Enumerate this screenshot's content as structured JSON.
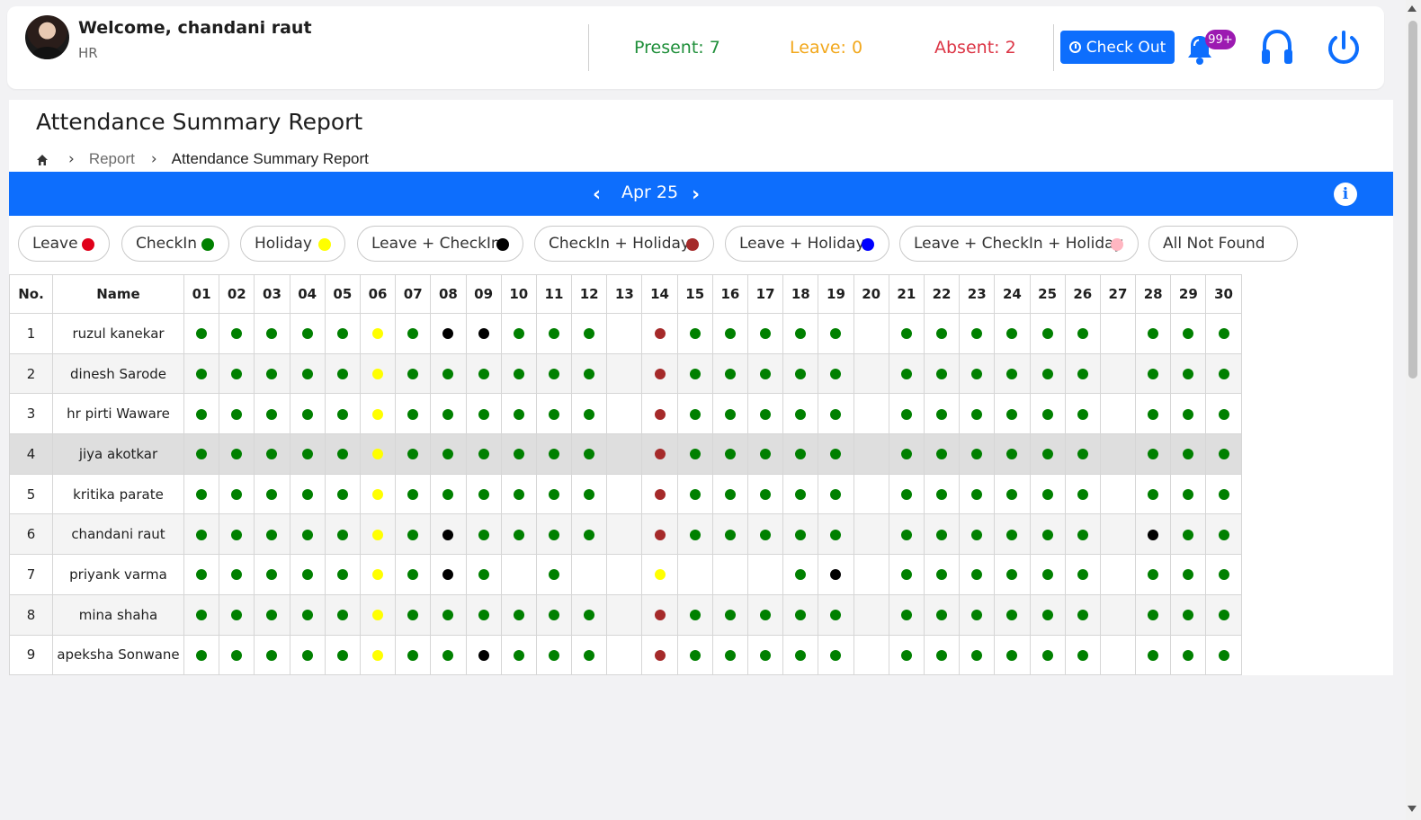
{
  "header": {
    "welcome": "Welcome, chandani raut",
    "role": "HR",
    "present": "Present: 7",
    "leave": "Leave: 0",
    "absent": "Absent: 2",
    "checkout_label": "Check Out",
    "notification_badge": "99+",
    "icons": [
      "clock-icon",
      "bell-icon",
      "headset-icon",
      "power-icon"
    ]
  },
  "page": {
    "title": "Attendance Summary Report",
    "breadcrumb": [
      "Report",
      "Attendance Summary Report"
    ]
  },
  "month": {
    "label": "Apr 25",
    "prev": "‹",
    "next": "›",
    "info": "i"
  },
  "legend": [
    {
      "label": "Leave",
      "color": "#e0001a"
    },
    {
      "label": "CheckIn",
      "color": "#008000"
    },
    {
      "label": "Holiday",
      "color": "#ffff00"
    },
    {
      "label": "Leave + CheckIn",
      "color": "#000000"
    },
    {
      "label": "CheckIn + Holiday",
      "color": "#a52a2a"
    },
    {
      "label": "Leave + Holiday",
      "color": "#0000ff"
    },
    {
      "label": "Leave + CheckIn + Holiday",
      "color": "#ffb6c1"
    },
    {
      "label": "All Not Found",
      "color": "#ffffff"
    }
  ],
  "colors": {
    "G": "#008000",
    "Y": "#ffff00",
    "B": "#000000",
    "R": "#a52a2a"
  },
  "table": {
    "headers": [
      "No.",
      "Name",
      "01",
      "02",
      "03",
      "04",
      "05",
      "06",
      "07",
      "08",
      "09",
      "10",
      "11",
      "12",
      "13",
      "14",
      "15",
      "16",
      "17",
      "18",
      "19",
      "20",
      "21",
      "22",
      "23",
      "24",
      "25",
      "26",
      "27",
      "28",
      "29",
      "30"
    ],
    "rows": [
      {
        "no": "1",
        "name": "ruzul kanekar",
        "days": "GGGGGYGBBGGG_RGGGGG_GGGGGG_GGG"
      },
      {
        "no": "2",
        "name": "dinesh Sarode",
        "days": "GGGGGYGGGGGG_RGGGGG_GGGGGG_GGG"
      },
      {
        "no": "3",
        "name": "hr pirti Waware",
        "days": "GGGGGYGGGGGG_RGGGGG_GGGGGG_GGG"
      },
      {
        "no": "4",
        "name": "jiya akotkar",
        "days": "GGGGGYGGGGGG_RGGGGG_GGGGGG_GGG"
      },
      {
        "no": "5",
        "name": "kritika parate",
        "days": "GGGGGYGGGGGG_RGGGGG_GGGGGG_GGG"
      },
      {
        "no": "6",
        "name": "chandani raut",
        "days": "GGGGGYGBGGGG_RGGGGG_GGGGGG_BGG"
      },
      {
        "no": "7",
        "name": "priyank varma",
        "days": "GGGGGYGBG_G__Y___GB_GGGGGG_GGG"
      },
      {
        "no": "8",
        "name": "mina shaha",
        "days": "GGGGGYGGGGGG_RGGGGG_GGGGGG_GGG"
      },
      {
        "no": "9",
        "name": "apeksha Sonwane",
        "days": "GGGGGYGGBGGG_RGGGGG_GGGGGG_GGG"
      }
    ]
  }
}
